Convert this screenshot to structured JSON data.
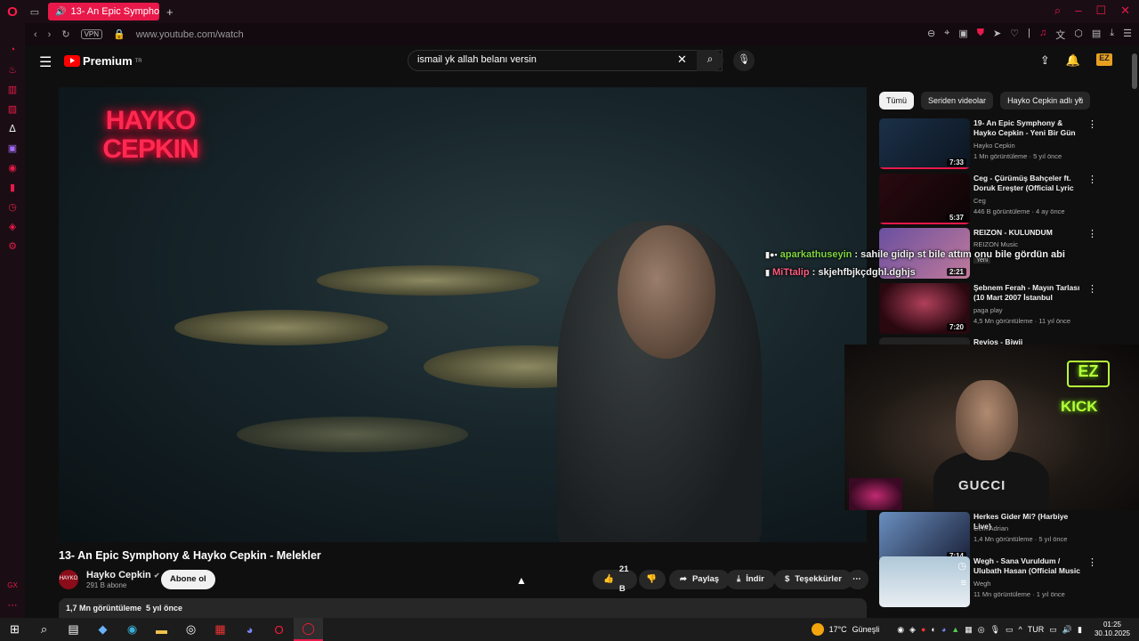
{
  "browser": {
    "tab_title": "13- An Epic Symphony",
    "url": "www.youtube.com/watch",
    "vpn_label": "VPN"
  },
  "header": {
    "logo_text": "Premium",
    "logo_sup": "TR",
    "search_value": "ismail yk allah belanı versin"
  },
  "video": {
    "neon_logo": "HAYKO CEPKIN",
    "title": "13- An Epic Symphony & Hayko Cepkin - Melekler",
    "channel": "Hayko Cepkin",
    "subscribers": "291 B abone",
    "subscribe_label": "Abone ol",
    "likes": "21 B",
    "share_label": "Paylaş",
    "download_label": "İndir",
    "thanks_label": "Teşekkürler",
    "views": "1,7 Mn görüntüleme",
    "age": "5 yıl önce"
  },
  "chips": [
    "Tümü",
    "Seriden videolar",
    "Hayko Cepkin adlı yü"
  ],
  "recommendations": [
    {
      "title": "19- An Epic Symphony & Hayko Cepkin - Yeni Bir Gün",
      "channel": "Hayko Cepkin",
      "meta": "1 Mn görüntüleme · 5 yıl önce",
      "duration": "7:33"
    },
    {
      "title": "Ceg - Çürümüş Bahçeler ft. Doruk Ereşter (Official Lyric ...",
      "channel": "Ceg",
      "meta": "446 B görüntüleme · 4 ay önce",
      "duration": "5:37"
    },
    {
      "title": "REIZON - KULUNDUM",
      "channel": "REIZON Music",
      "meta": "",
      "badge": "Yeni",
      "duration": "2:21"
    },
    {
      "title": "Şebnem Ferah - Mayın Tarlası (10 Mart 2007 İstanbul Konseri)",
      "channel": "paga play",
      "meta": "4,5 Mn görüntüleme · 11 yıl önce",
      "duration": "7:20"
    },
    {
      "title": "Revios - Biwij",
      "channel": "",
      "meta": "",
      "duration": ""
    },
    {
      "title": "Herkes Gider Mi? (Harbiye Live)",
      "channel": "Cem Adrian",
      "meta": "1,4 Mn görüntüleme · 5 yıl önce",
      "duration": "7:14"
    },
    {
      "title": "Wegh - Sana Vuruldum / Ulubath Hasan (Official Music ...",
      "channel": "Wegh",
      "meta": "11 Mn görüntüleme · 1 yıl önce",
      "duration": ""
    }
  ],
  "chat": [
    {
      "user": "aparkathuseyin",
      "message": " : sahile gidip st bile attım onu bile gördün abi"
    },
    {
      "user": "MiTtalip",
      "message": " : skjehfbjkçdghl.dghjs"
    }
  ],
  "webcam": {
    "ez_text": "EZ",
    "kick_text": "KICK",
    "shirt_text": "GUCCI"
  },
  "taskbar": {
    "weather_temp": "17°C",
    "weather_desc": "Güneşli",
    "lang": "TUR",
    "time": "01:25",
    "date": "30.10.2025"
  },
  "colors": {
    "accent": "#e8194a",
    "yt_red": "#ff0000",
    "neon": "#b7ff3a"
  }
}
